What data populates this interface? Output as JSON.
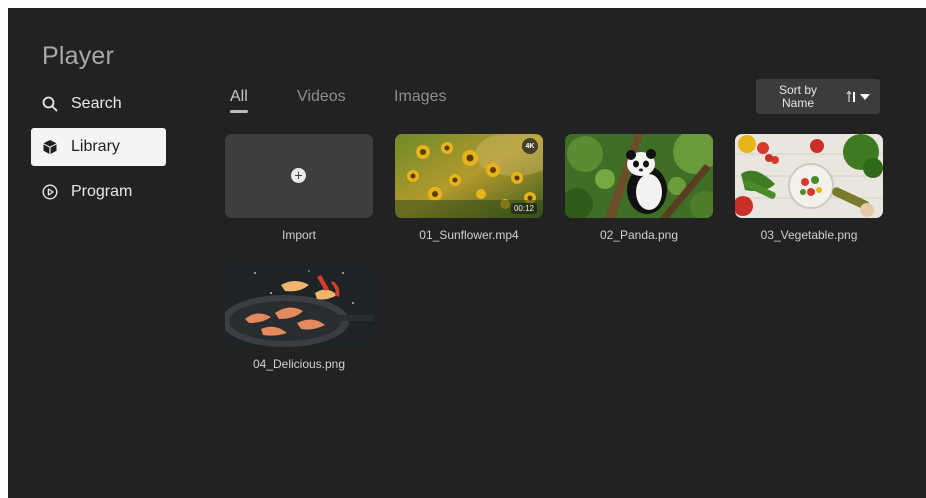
{
  "app": {
    "title": "Player"
  },
  "sidebar": {
    "items": [
      {
        "label": "Search",
        "icon": "search-icon",
        "active": false
      },
      {
        "label": "Library",
        "icon": "library-cube-icon",
        "active": true
      },
      {
        "label": "Program",
        "icon": "play-circle-icon",
        "active": false
      }
    ]
  },
  "tabs": [
    {
      "label": "All",
      "active": true
    },
    {
      "label": "Videos",
      "active": false
    },
    {
      "label": "Images",
      "active": false
    }
  ],
  "sort": {
    "line1": "Sort by",
    "line2": "Name",
    "icon": "sort-order-icon",
    "dropdown_icon": "caret-down-icon"
  },
  "library": {
    "import": {
      "label": "Import",
      "icon": "plus-circle-icon"
    },
    "items": [
      {
        "name": "01_Sunflower.mp4",
        "type": "video",
        "badge": "4K",
        "duration": "00:12",
        "thumb": "sunflower-field"
      },
      {
        "name": "02_Panda.png",
        "type": "image",
        "thumb": "panda-in-tree"
      },
      {
        "name": "03_Vegetable.png",
        "type": "image",
        "thumb": "vegetables-on-table"
      },
      {
        "name": "04_Delicious.png",
        "type": "image",
        "thumb": "shrimp-in-pan"
      }
    ]
  },
  "colors": {
    "background": "#222222",
    "active_item": "#f4f4f4",
    "tile": "#3e3e3e"
  }
}
